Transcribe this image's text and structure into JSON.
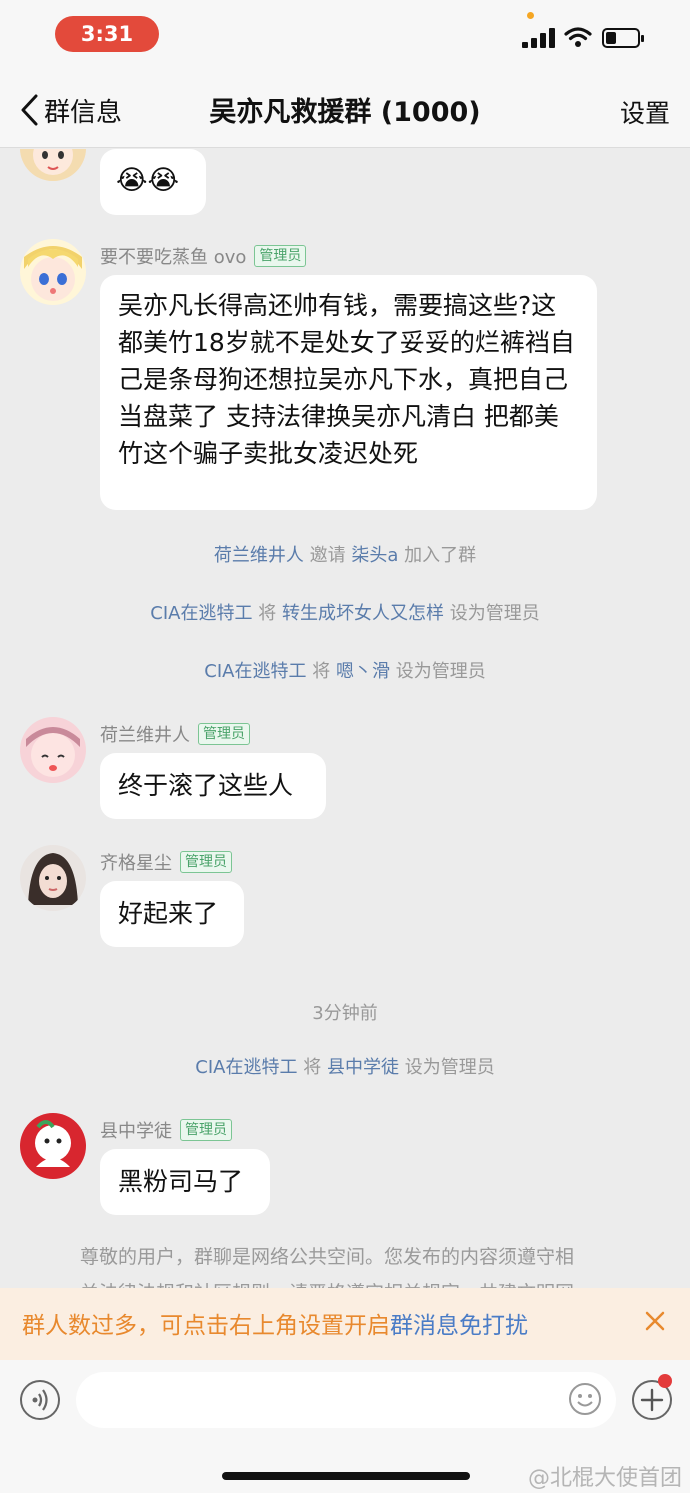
{
  "status_bar": {
    "time": "3:31"
  },
  "nav": {
    "back_label": "群信息",
    "title": "吴亦凡救援群 (1000)",
    "settings_label": "设置"
  },
  "messages": [
    {
      "text": "😭😭"
    },
    {
      "sender": "要不要吃蒸鱼 ovo",
      "badge": "管理员",
      "text": "吴亦凡长得高还帅有钱，需要搞这些?这都美竹18岁就不是处女了妥妥的烂裤裆自己是条母狗还想拉吴亦凡下水，真把自己当盘菜了 支持法律换吴亦凡清白 把都美竹这个骗子卖批女凌迟处死"
    },
    {
      "sender": "荷兰维井人",
      "badge": "管理员",
      "text": "终于滚了这些人"
    },
    {
      "sender": "齐格星尘",
      "badge": "管理员",
      "text": "好起来了"
    },
    {
      "sender": "县中学徒",
      "badge": "管理员",
      "text": "黑粉司马了"
    }
  ],
  "system": [
    {
      "a": "荷兰维井人",
      "verb": "邀请",
      "b": "柒头a",
      "tail": "加入了群"
    },
    {
      "a": "CIA在逃特工",
      "verb": "将",
      "b": "转生成坏女人又怎样",
      "tail": "设为管理员"
    },
    {
      "a": "CIA在逃特工",
      "verb": "将",
      "b": "嗯丶滑",
      "tail": "设为管理员"
    },
    {
      "a": "CIA在逃特工",
      "verb": "将",
      "b": "县中学徒",
      "tail": "设为管理员"
    }
  ],
  "timestamp": "3分钟前",
  "notice": {
    "line1": "尊敬的用户，群聊是网络公共空间。您发布的内容须遵守相",
    "line2": "关法律法规和社区规则，请严格遵守相关规定，共建文明网"
  },
  "banner": {
    "text": "群人数过多，可点击右上角设置开启",
    "link": "群消息免打扰"
  },
  "watermark": "@北棍大使首团",
  "colors": {
    "accent_link": "#5a7cab",
    "banner_text": "#e8892e",
    "badge_green": "#4aa36a",
    "time_pill": "#e34a3b"
  }
}
